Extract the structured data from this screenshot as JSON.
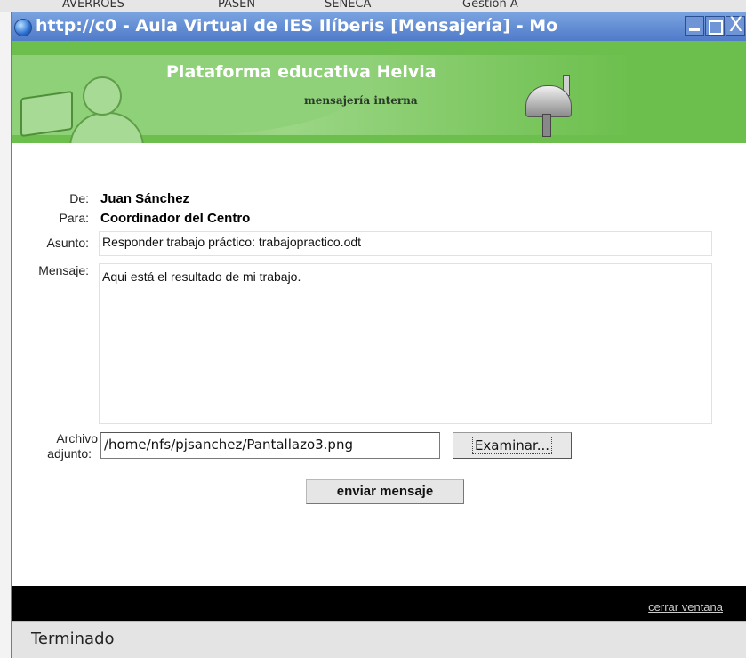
{
  "background": {
    "tabs": [
      "AVERROES",
      "PASEN",
      "SENECA",
      "Gestión A"
    ]
  },
  "window": {
    "title": "http://c0 - Aula Virtual de IES Ilíberis [Mensajería] - Mo",
    "close_glyph": "X"
  },
  "banner": {
    "platform": "Plataforma educativa Helvia",
    "subtitle": "mensajería interna"
  },
  "form": {
    "from_label": "De:",
    "from_value": "Juan Sánchez",
    "to_label": "Para:",
    "to_value": "Coordinador del Centro",
    "subject_label": "Asunto:",
    "subject_value": "Responder trabajo práctico: trabajopractico.odt",
    "message_label": "Mensaje:",
    "message_value": "Aqui está el resultado de mi trabajo.",
    "attachment_label_1": "Archivo",
    "attachment_label_2": "adjunto:",
    "attachment_value": "/home/nfs/pjsanchez/Pantallazo3.png",
    "browse_label": "Examinar...",
    "send_label": "enviar mensaje"
  },
  "footer": {
    "close_link": "cerrar ventana"
  },
  "statusbar": {
    "status": "Terminado"
  }
}
